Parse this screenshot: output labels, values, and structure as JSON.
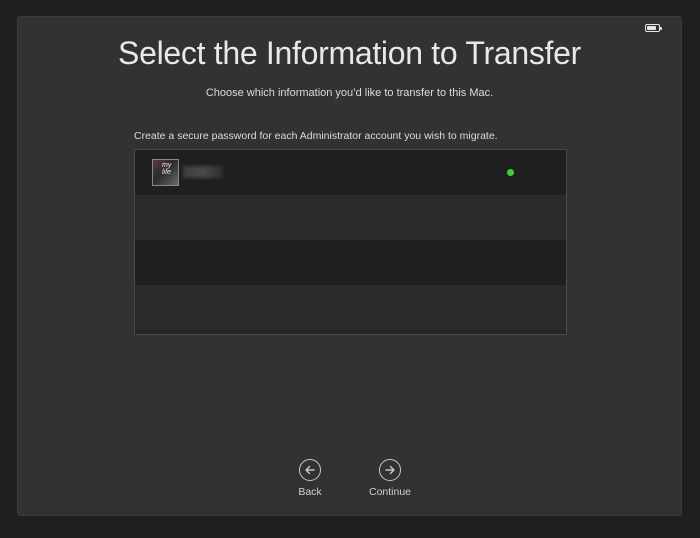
{
  "window": {
    "title": "Select the Information to Transfer",
    "subtitle": "Choose which information you’d like to transfer to this Mac.",
    "instruction": "Create a secure password for each Administrator account you wish to migrate."
  },
  "accounts": [
    {
      "avatar_text_line1": "my",
      "avatar_text_line2": "life",
      "username": "",
      "status": "green-dot"
    }
  ],
  "navigation": {
    "back_label": "Back",
    "continue_label": "Continue",
    "back_icon": "arrow-left-circle-icon",
    "continue_icon": "arrow-right-circle-icon"
  },
  "colors": {
    "status_dot": "#3fd13a",
    "window_bg": "#323232",
    "text": "#e8e8e8"
  }
}
